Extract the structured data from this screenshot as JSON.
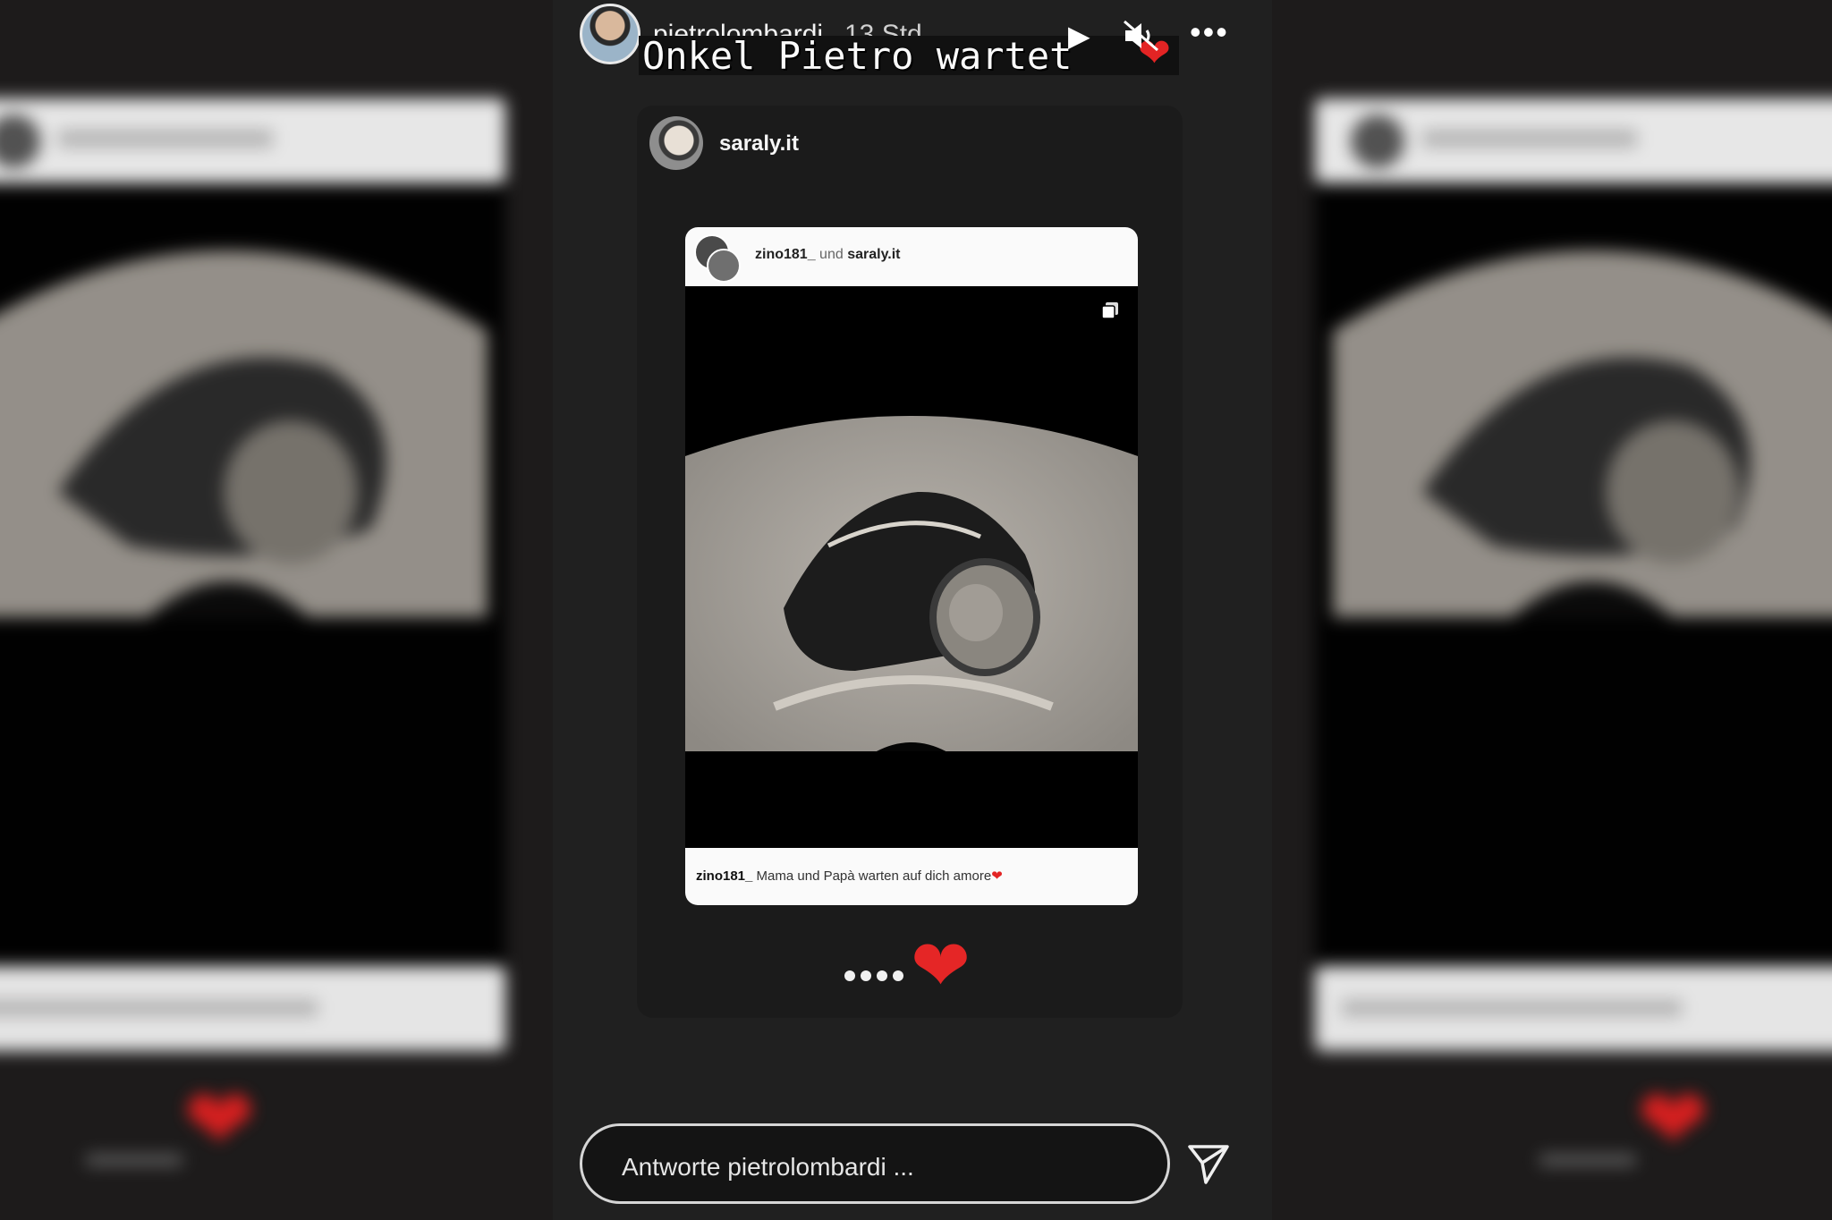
{
  "story": {
    "username": "pietrolombardi",
    "timestamp": "13 Std.",
    "caption": "Onkel Pietro wartet",
    "controls": {
      "play_icon": "play-icon",
      "mute_icon": "muted-speaker-icon",
      "more_icon": "more-options-icon"
    }
  },
  "shared_post": {
    "author": "saraly.it",
    "inner_post": {
      "user_a": "zino181_",
      "joiner": "und",
      "user_b": "saraly.it",
      "caption_user": "zino181_",
      "caption_text": "Mama und Papà warten auf dich amore",
      "caption_emoji": "❤"
    },
    "dots": "••••",
    "heart": "❤"
  },
  "reply": {
    "placeholder": "Antworte pietrolombardi ..."
  },
  "colors": {
    "accent_heart": "#e32424",
    "background": "#1d1b1b"
  }
}
